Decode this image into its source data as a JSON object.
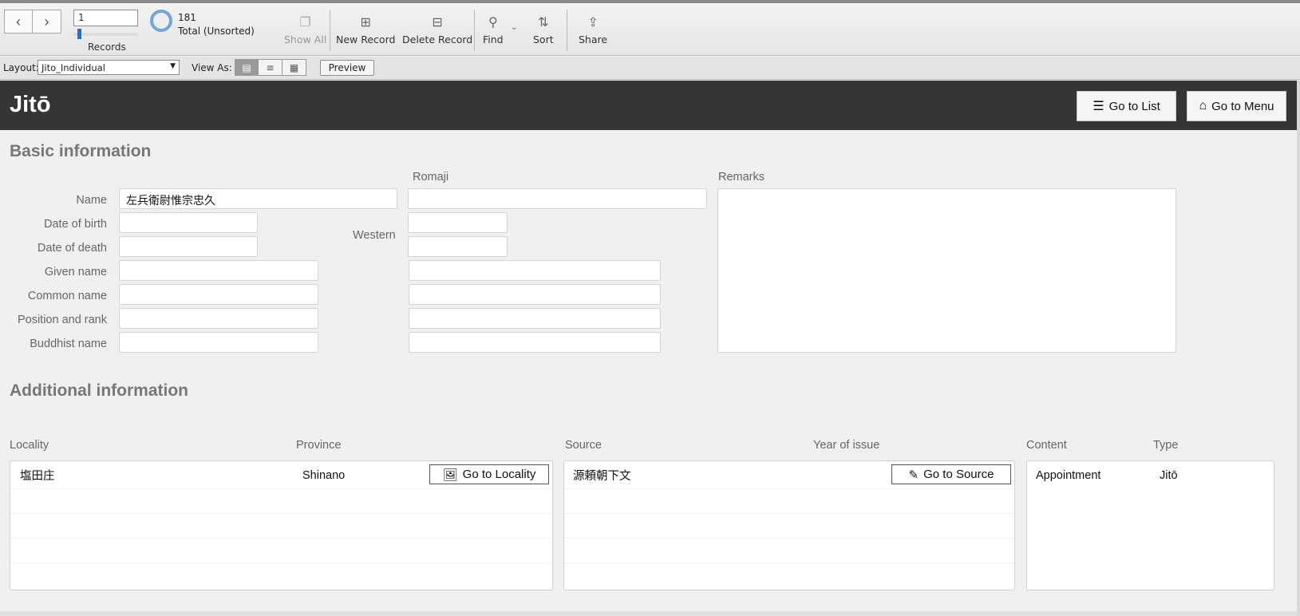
{
  "toolbar": {
    "record_number": "1",
    "records_label": "Records",
    "total_count": "181",
    "total_label": "Total (Unsorted)",
    "show_all": "Show All",
    "new_record": "New Record",
    "delete_record": "Delete Record",
    "find": "Find",
    "sort": "Sort",
    "share": "Share",
    "record_slider_progress": 0.06
  },
  "layoutbar": {
    "layout_label": "Layout:",
    "layout_value": "Jito_Individual",
    "view_as_label": "View As:",
    "preview": "Preview"
  },
  "header": {
    "title": "Jitō",
    "go_to_list": "Go to List",
    "go_to_menu": "Go to Menu"
  },
  "basic": {
    "section_title": "Basic information",
    "romaji_label": "Romaji",
    "remarks_label": "Remarks",
    "western_label": "Western",
    "labels": {
      "name": "Name",
      "date_of_birth": "Date of birth",
      "date_of_death": "Date of death",
      "given_name": "Given name",
      "common_name": "Common name",
      "position_and_rank": "Position and rank",
      "buddhist_name": "Buddhist name"
    },
    "values": {
      "name": "左兵衛尉惟宗忠久",
      "name_romaji": "",
      "date_of_birth": "",
      "date_of_death": "",
      "birth_western": "",
      "death_western": "",
      "given_name": "",
      "given_name_romaji": "",
      "common_name": "",
      "common_name_romaji": "",
      "position_and_rank": "",
      "position_and_rank_romaji": "",
      "buddhist_name": "",
      "buddhist_name_romaji": "",
      "remarks": ""
    }
  },
  "additional": {
    "section_title": "Additional information",
    "locality_portal": {
      "headers": [
        "Locality",
        "Province"
      ],
      "rows": [
        {
          "locality": "塩田庄",
          "province": "Shinano"
        }
      ],
      "button": "Go to Locality"
    },
    "source_portal": {
      "headers": [
        "Source",
        "Year of issue"
      ],
      "rows": [
        {
          "source": "源頼朝下文",
          "year": ""
        }
      ],
      "button": "Go to Source"
    },
    "content_portal": {
      "headers": [
        "Content",
        "Type"
      ],
      "rows": [
        {
          "content": "Appointment",
          "type": "Jitō"
        }
      ]
    }
  }
}
